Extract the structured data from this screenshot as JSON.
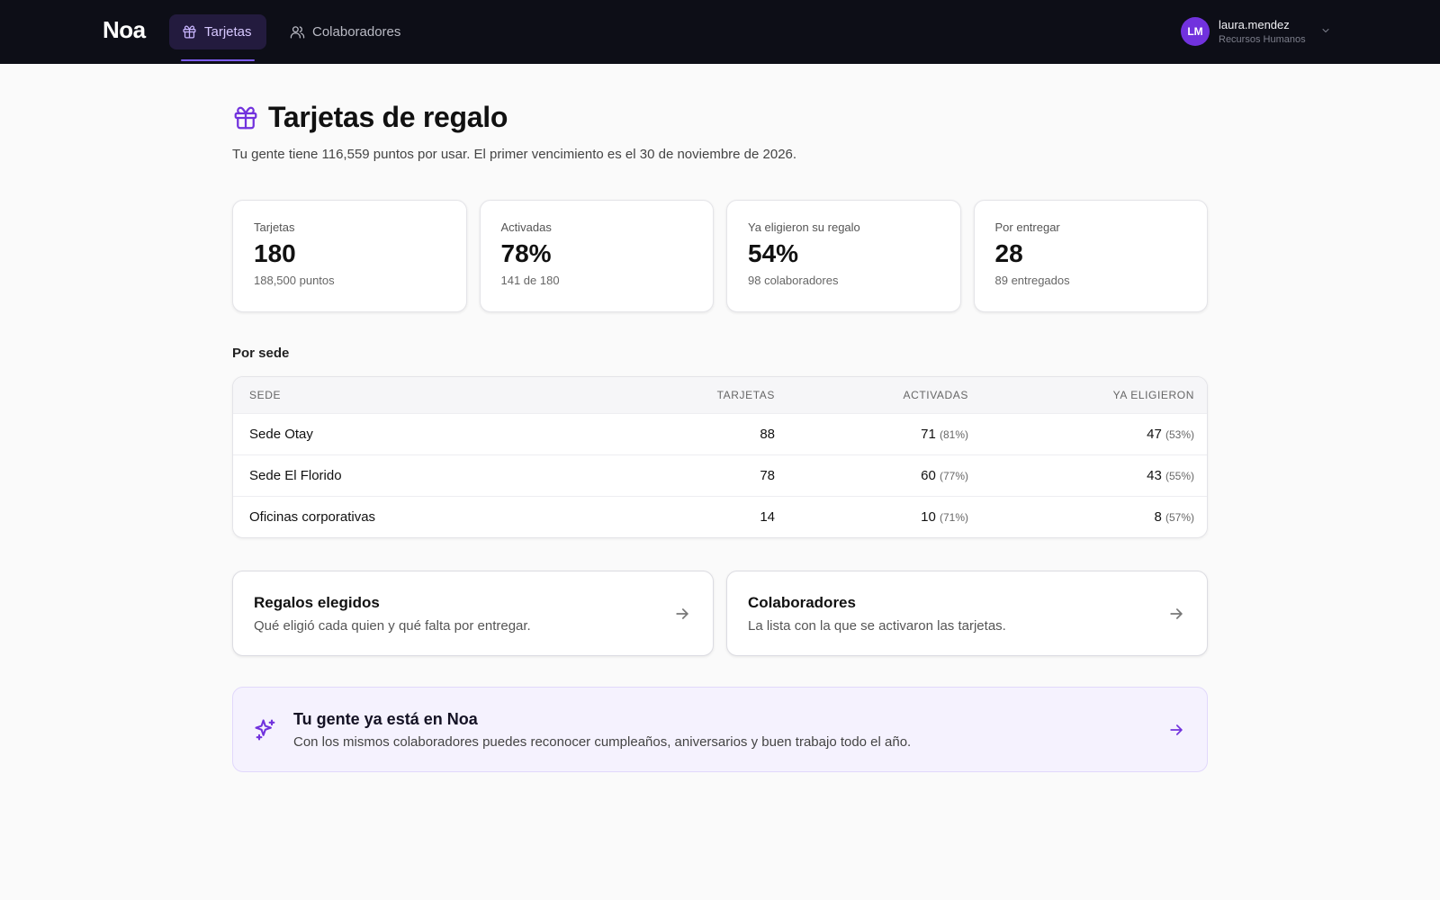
{
  "nav": {
    "logo": "Noa",
    "tabs": [
      {
        "label": "Tarjetas"
      },
      {
        "label": "Colaboradores"
      }
    ]
  },
  "user": {
    "initials": "LM",
    "name": "laura.mendez",
    "role": "Recursos Humanos"
  },
  "page": {
    "title": "Tarjetas de regalo",
    "subtitle": "Tu gente tiene 116,559 puntos por usar. El primer vencimiento es el 30 de noviembre de 2026."
  },
  "stats": [
    {
      "label": "Tarjetas",
      "value": "180",
      "sub": "188,500 puntos"
    },
    {
      "label": "Activadas",
      "value": "78%",
      "sub": "141 de 180"
    },
    {
      "label": "Ya eligieron su regalo",
      "value": "54%",
      "sub": "98 colaboradores"
    },
    {
      "label": "Por entregar",
      "value": "28",
      "sub": "89 entregados"
    }
  ],
  "by_site": {
    "title": "Por sede",
    "headers": {
      "sede": "SEDE",
      "tarjetas": "TARJETAS",
      "activadas": "ACTIVADAS",
      "eligieron": "YA ELIGIERON"
    },
    "rows": [
      {
        "sede": "Sede Otay",
        "tarjetas": "88",
        "activadas": "71",
        "activadas_pct": "(81%)",
        "eligieron": "47",
        "eligieron_pct": "(53%)"
      },
      {
        "sede": "Sede El Florido",
        "tarjetas": "78",
        "activadas": "60",
        "activadas_pct": "(77%)",
        "eligieron": "43",
        "eligieron_pct": "(55%)"
      },
      {
        "sede": "Oficinas corporativas",
        "tarjetas": "14",
        "activadas": "10",
        "activadas_pct": "(71%)",
        "eligieron": "8",
        "eligieron_pct": "(57%)"
      }
    ]
  },
  "links": [
    {
      "title": "Regalos elegidos",
      "desc": "Qué eligió cada quien y qué falta por entregar."
    },
    {
      "title": "Colaboradores",
      "desc": "La lista con la que se activaron las tarjetas."
    }
  ],
  "promo": {
    "title": "Tu gente ya está en Noa",
    "desc": "Con los mismos colaboradores puedes reconocer cumpleaños, aniversarios y buen trabajo todo el año."
  },
  "colors": {
    "accent": "#7132dd",
    "topbar": "#0d0e17"
  },
  "icons": {
    "tab_tarjetas": "gift-icon",
    "tab_colaboradores": "users-icon",
    "page_title": "gift-icon",
    "user_menu": "chevron-down-icon",
    "link": "arrow-right-icon",
    "promo": "sparkles-icon"
  }
}
